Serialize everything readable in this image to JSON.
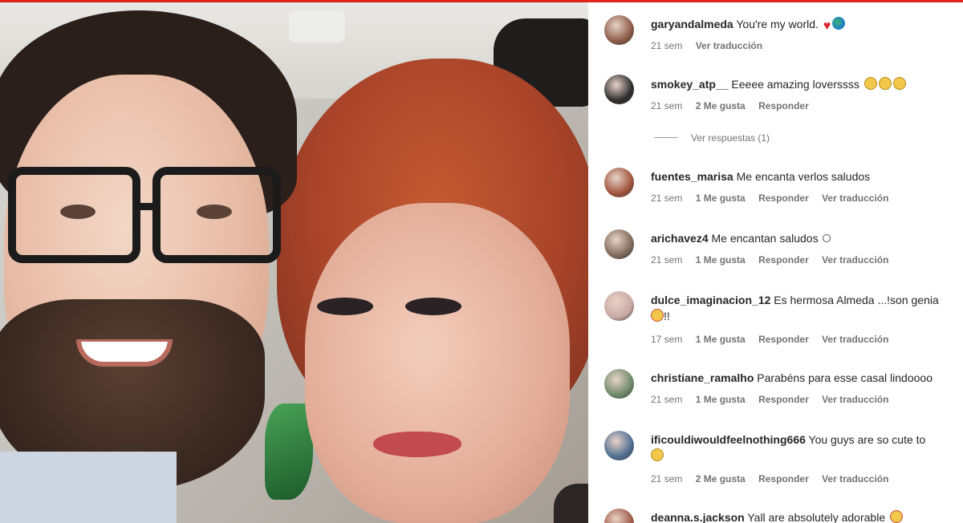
{
  "comments": [
    {
      "username": "garyandalmeda",
      "text": "You're my world.",
      "emojis": [
        "heart",
        "globe"
      ],
      "time": "21 sem",
      "likes": "",
      "reply": "",
      "translate": "Ver traducción",
      "avatar_color": "#8d5a47"
    },
    {
      "username": "smokey_atp__",
      "text": "Eeeee amazing loverssss",
      "emojis": [
        "sad",
        "sad",
        "sad"
      ],
      "time": "21 sem",
      "likes": "2 Me gusta",
      "reply": "Responder",
      "translate": "",
      "avatar_color": "#2d2d2d"
    },
    {
      "username": "fuentes_marisa",
      "text": "Me encanta verlos saludos",
      "emojis": [],
      "time": "21 sem",
      "likes": "1 Me gusta",
      "reply": "Responder",
      "translate": "Ver traducción",
      "avatar_color": "#a0543c"
    },
    {
      "username": "arichavez4",
      "text": "Me encantan saludos",
      "emojis": [
        "small"
      ],
      "time": "21 sem",
      "likes": "1 Me gusta",
      "reply": "Responder",
      "translate": "Ver traducción",
      "avatar_color": "#7f6a5c"
    },
    {
      "username": "dulce_imaginacion_12",
      "text": "Es hermosa Almeda ...!son genia",
      "text_line2": "!!",
      "emojis": [
        "love"
      ],
      "time": "17 sem",
      "likes": "1 Me gusta",
      "reply": "Responder",
      "translate": "Ver traducción",
      "avatar_color": "#c9a9a5"
    },
    {
      "username": "christiane_ramalho",
      "text": "Parabéns para esse casal lindoooo",
      "emojis": [],
      "time": "21 sem",
      "likes": "1 Me gusta",
      "reply": "Responder",
      "translate": "Ver traducción",
      "avatar_color": "#6e8a6a"
    },
    {
      "username": "ificouldiwouldfeelnothing666",
      "text": "You guys are so cute to",
      "emojis": [
        "smile"
      ],
      "time": "21 sem",
      "likes": "2 Me gusta",
      "reply": "Responder",
      "translate": "Ver traducción",
      "avatar_color": "#4f6f93"
    },
    {
      "username": "deanna.s.jackson",
      "text": "Yall are absolutely adorable",
      "emojis": [
        "love"
      ],
      "time": "",
      "likes": "",
      "reply": "",
      "translate": "",
      "avatar_color": "#a05a47"
    }
  ],
  "replies_link": "Ver respuestas (1)",
  "colors": {
    "accent_strip": "#e0241b",
    "text": "#262626",
    "muted": "#737373"
  }
}
